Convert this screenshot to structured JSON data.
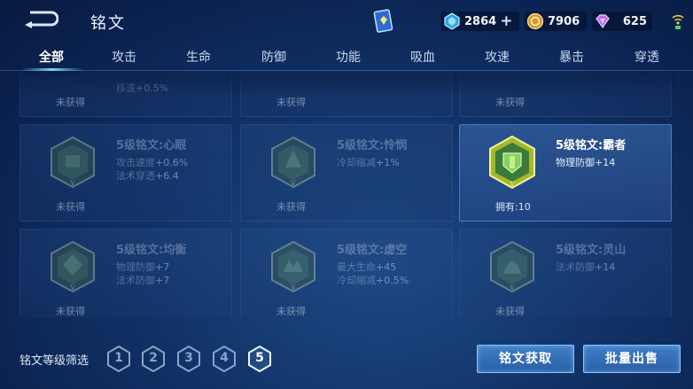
{
  "header": {
    "title": "铭文",
    "back_icon": "back-arrow-icon",
    "card_icon": "inscription-card-icon"
  },
  "currencies": {
    "diamond": {
      "value": "2864",
      "icon": "diamond-icon",
      "plus": "+"
    },
    "gold": {
      "value": "7906",
      "icon": "gold-coin-icon"
    },
    "gem": {
      "value": "625",
      "icon": "purple-gem-icon"
    }
  },
  "tabs": [
    {
      "label": "全部",
      "active": true
    },
    {
      "label": "攻击"
    },
    {
      "label": "生命"
    },
    {
      "label": "防御"
    },
    {
      "label": "功能"
    },
    {
      "label": "吸血"
    },
    {
      "label": "攻速"
    },
    {
      "label": "暴击"
    },
    {
      "label": "穿透"
    }
  ],
  "inscriptions": {
    "row0": [
      {
        "attr1_name": "移速",
        "attr1_val": "+0.5%",
        "status": "未获得"
      },
      {
        "status": "未获得"
      },
      {
        "status": "未获得"
      }
    ],
    "row1": [
      {
        "name": "5级铭文:心眼",
        "attr1_name": "攻击速度",
        "attr1_val": "+0.6%",
        "attr2_name": "法术穿透",
        "attr2_val": "+6.4",
        "status": "未获得"
      },
      {
        "name": "5级铭文:怜悯",
        "attr1_name": "冷却缩减",
        "attr1_val": "+1%",
        "status": "未获得"
      },
      {
        "name": "5级铭文:霸者",
        "attr1_name": "物理防御",
        "attr1_val": "+14",
        "status": "拥有:10"
      }
    ],
    "row2": [
      {
        "name": "5级铭文:均衡",
        "attr1_name": "物理防御",
        "attr1_val": "+7",
        "attr2_name": "法术防御",
        "attr2_val": "+7",
        "status": "未获得"
      },
      {
        "name": "5级铭文:虚空",
        "attr1_name": "最大生命",
        "attr1_val": "+45",
        "attr2_name": "冷却缩减",
        "attr2_val": "+0.5%",
        "status": "未获得"
      },
      {
        "name": "5级铭文:灵山",
        "attr1_name": "法术防御",
        "attr1_val": "+14",
        "status": "未获得"
      }
    ]
  },
  "filter": {
    "label": "铭文等级筛选",
    "levels": [
      "1",
      "2",
      "3",
      "4",
      "5"
    ],
    "selected": "5"
  },
  "actions": {
    "obtain": "铭文获取",
    "sell": "批量出售"
  },
  "colors": {
    "accent": "#7fd0ff",
    "button": "#3f7fc8",
    "owned_hex": "#c8d43a"
  }
}
